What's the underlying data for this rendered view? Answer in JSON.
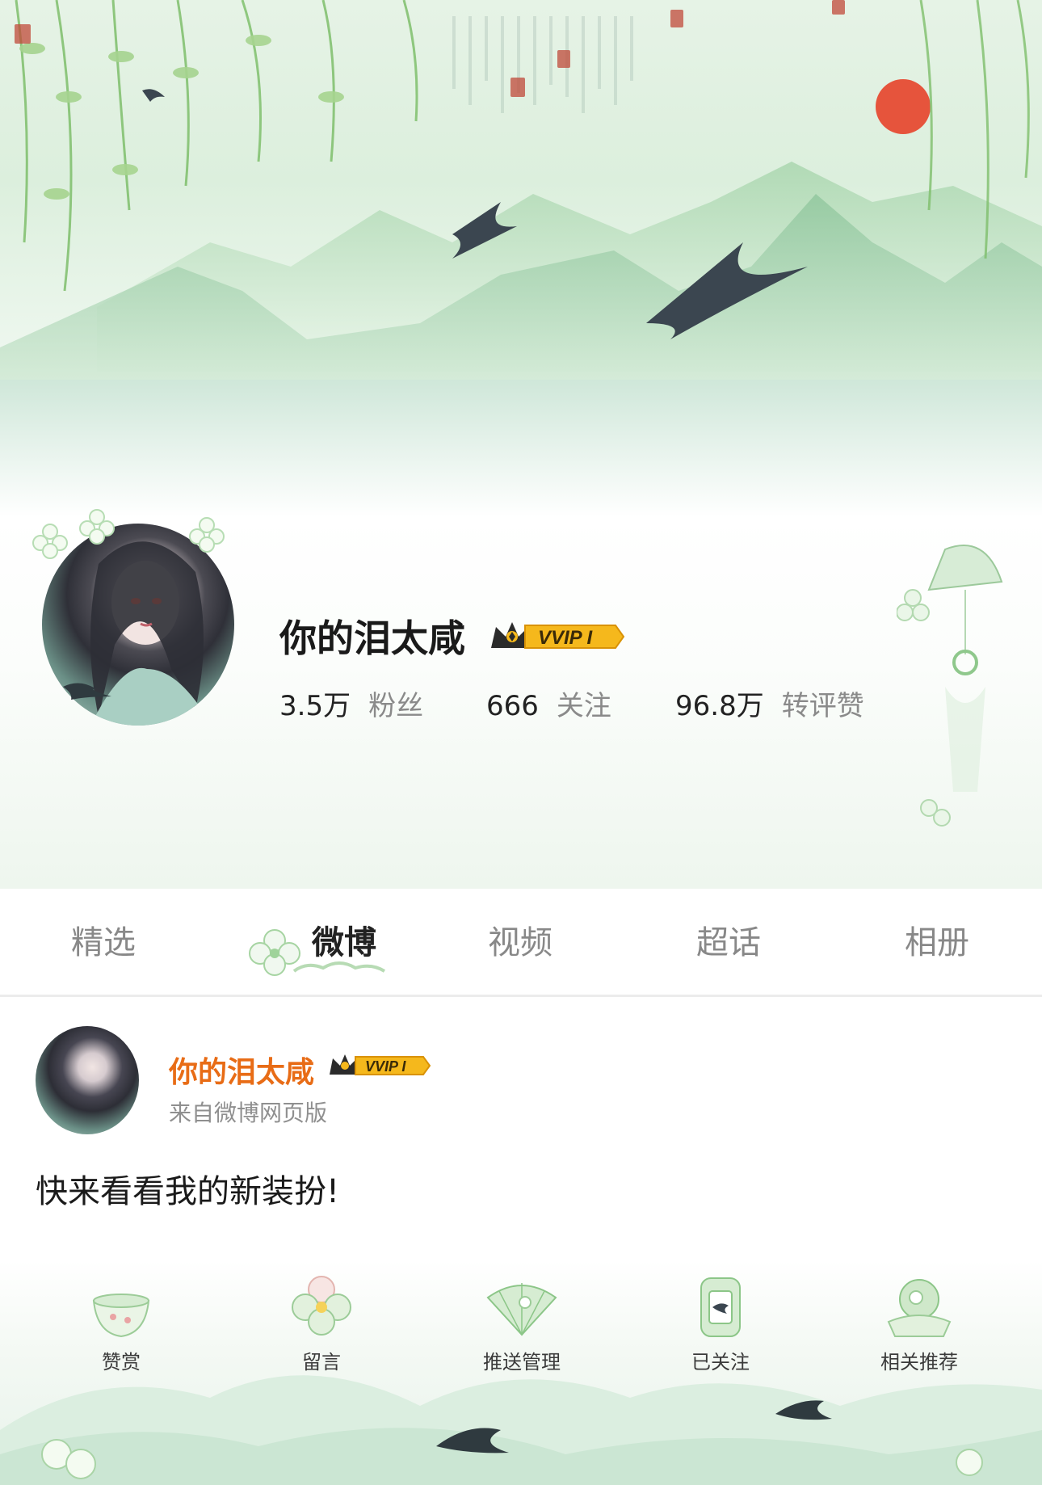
{
  "profile": {
    "username": "你的泪太咸",
    "vip": "VVIP I",
    "stats": [
      {
        "value": "3.5万",
        "label": "粉丝"
      },
      {
        "value": "666",
        "label": "关注"
      },
      {
        "value": "96.8万",
        "label": "转评赞"
      }
    ]
  },
  "tabs": [
    {
      "label": "精选"
    },
    {
      "label": "微博"
    },
    {
      "label": "视频"
    },
    {
      "label": "超话"
    },
    {
      "label": "相册"
    }
  ],
  "active_tab": "微博",
  "post": {
    "author": "你的泪太咸",
    "vip": "VVIP I",
    "source": "来自微博网页版",
    "text": "快来看看我的新装扮!"
  },
  "actions": [
    {
      "label": "赞赏",
      "icon": "tea-cup-icon"
    },
    {
      "label": "留言",
      "icon": "flower-icon"
    },
    {
      "label": "推送管理",
      "icon": "fan-icon"
    },
    {
      "label": "已关注",
      "icon": "lantern-icon"
    },
    {
      "label": "相关推荐",
      "icon": "ball-icon"
    }
  ],
  "colors": {
    "accent_orange": "#e86c16",
    "vip_gold": "#f5b81c",
    "theme_green": "#9fd39a"
  }
}
